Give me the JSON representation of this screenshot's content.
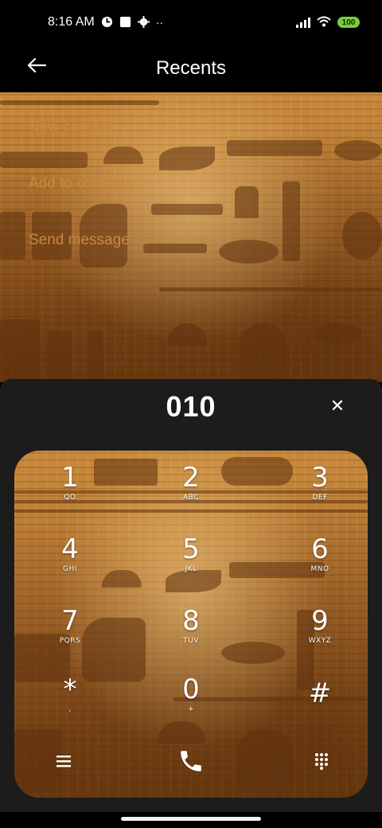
{
  "status_bar": {
    "time": "8:16 AM",
    "battery": "100",
    "icons": [
      "media-icon",
      "square-icon",
      "settings-icon",
      "more-dots-icon",
      "signal-icon",
      "wifi-icon",
      "battery-icon"
    ]
  },
  "header": {
    "title": "Recents",
    "back_icon": "arrow-left-icon"
  },
  "menu": {
    "items": [
      {
        "label": "New contact"
      },
      {
        "label": "Add to contacts"
      },
      {
        "label": "Send message"
      }
    ]
  },
  "dialer": {
    "number": "010",
    "clear_icon": "close-icon",
    "keys": [
      {
        "digit": "1",
        "letters": "QO"
      },
      {
        "digit": "2",
        "letters": "ABC"
      },
      {
        "digit": "3",
        "letters": "DEF"
      },
      {
        "digit": "4",
        "letters": "GHI"
      },
      {
        "digit": "5",
        "letters": "JKL"
      },
      {
        "digit": "6",
        "letters": "MNO"
      },
      {
        "digit": "7",
        "letters": "PQRS"
      },
      {
        "digit": "8",
        "letters": "TUV"
      },
      {
        "digit": "9",
        "letters": "WXYZ"
      },
      {
        "digit": "*",
        "letters": ","
      },
      {
        "digit": "0",
        "letters": "+"
      },
      {
        "digit": "#",
        "letters": ""
      }
    ],
    "actions": {
      "menu_icon": "hamburger-menu-icon",
      "call_icon": "phone-icon",
      "keypad_icon": "dialpad-icon"
    }
  },
  "colors": {
    "menu_text": "#c9893c",
    "panel_bg": "#1c1c1c",
    "battery": "#7ccc3a"
  }
}
